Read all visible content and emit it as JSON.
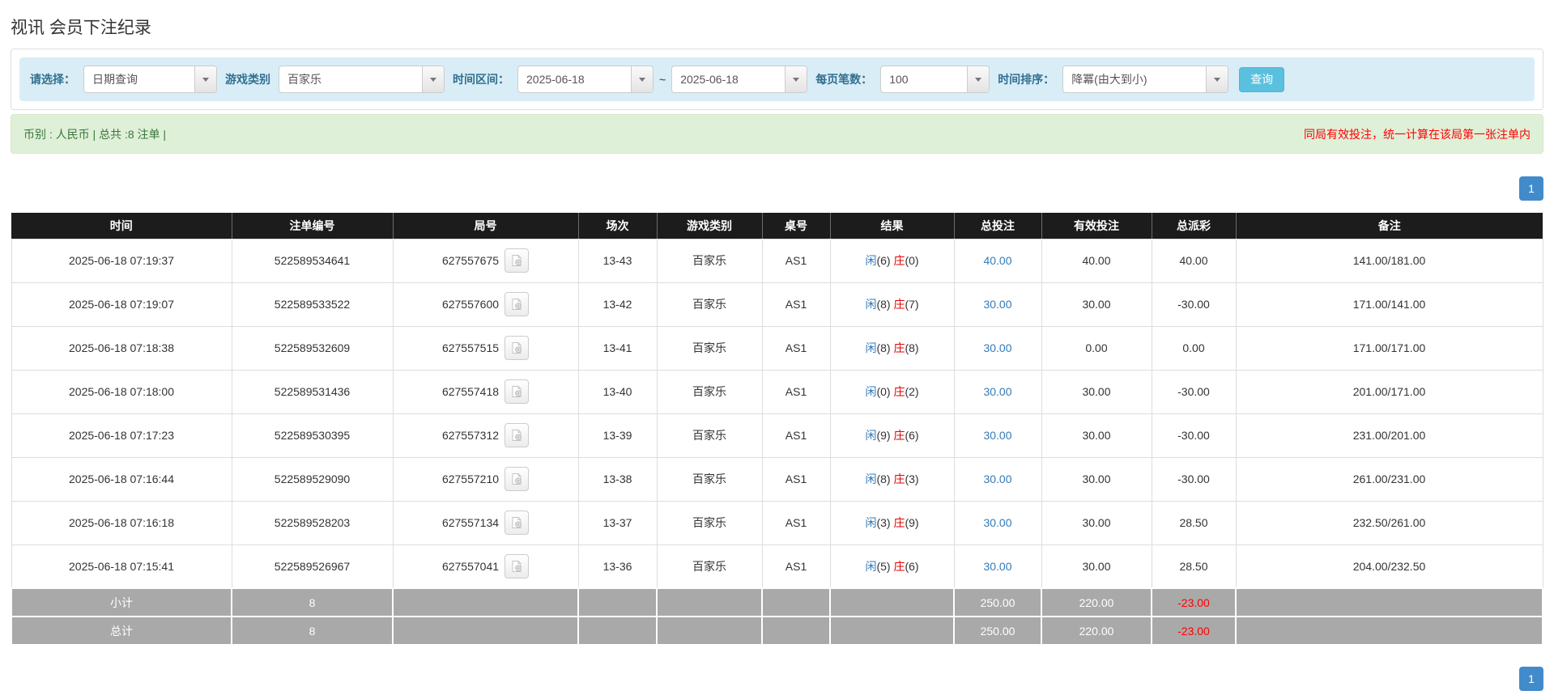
{
  "page": {
    "title": "视讯 会员下注纪录"
  },
  "filters": {
    "select_label": "请选择：",
    "select_value": "日期查询",
    "game_label": "游戏类别",
    "game_value": "百家乐",
    "range_label": "时间区间：",
    "date_from": "2025-06-18",
    "tilde": "~",
    "date_to": "2025-06-18",
    "per_page_label": "每页笔数：",
    "per_page_value": "100",
    "sort_label": "时间排序：",
    "sort_value": "降冪(由大到小)",
    "search_button": "查询"
  },
  "summary": {
    "left": "币别 : 人民币 | 总共 :8 注单 |",
    "right": "同局有效投注，统一计算在该局第一张注单内"
  },
  "pagination": {
    "page": "1"
  },
  "icons": {
    "round_video": "film-record-icon",
    "select_arrow": "chevron-down-icon"
  },
  "colors": {
    "accent_button": "#5bc0de",
    "filter_bar_bg": "#d9edf7",
    "filter_label": "#31708f",
    "alert_bg": "#dff0d8",
    "alert_text": "#3c763d",
    "notice_red": "#ff0000",
    "header_bg": "#1c1c1c",
    "link_blue": "#337ab7",
    "banker_red": "#e60000",
    "summary_row_bg": "#a9a9a9",
    "pager_blue": "#428bca"
  },
  "table": {
    "columns": [
      "时间",
      "注单编号",
      "局号",
      "场次",
      "游戏类别",
      "桌号",
      "结果",
      "总投注",
      "有效投注",
      "总派彩",
      "备注"
    ],
    "rows": [
      {
        "time": "2025-06-18 07:19:37",
        "bet_id": "522589534641",
        "round": "627557675",
        "session": "13-43",
        "game": "百家乐",
        "table_no": "AS1",
        "result": {
          "xian_label": "闲",
          "xian_num": "(6)",
          "zhuang_label": "庄",
          "zhuang_num": "(0)"
        },
        "total_bet": "40.00",
        "valid_bet": "40.00",
        "payout": "40.00",
        "remark": "141.00/181.00"
      },
      {
        "time": "2025-06-18 07:19:07",
        "bet_id": "522589533522",
        "round": "627557600",
        "session": "13-42",
        "game": "百家乐",
        "table_no": "AS1",
        "result": {
          "xian_label": "闲",
          "xian_num": "(8)",
          "zhuang_label": "庄",
          "zhuang_num": "(7)"
        },
        "total_bet": "30.00",
        "valid_bet": "30.00",
        "payout": "-30.00",
        "remark": "171.00/141.00"
      },
      {
        "time": "2025-06-18 07:18:38",
        "bet_id": "522589532609",
        "round": "627557515",
        "session": "13-41",
        "game": "百家乐",
        "table_no": "AS1",
        "result": {
          "xian_label": "闲",
          "xian_num": "(8)",
          "zhuang_label": "庄",
          "zhuang_num": "(8)"
        },
        "total_bet": "30.00",
        "valid_bet": "0.00",
        "payout": "0.00",
        "remark": "171.00/171.00"
      },
      {
        "time": "2025-06-18 07:18:00",
        "bet_id": "522589531436",
        "round": "627557418",
        "session": "13-40",
        "game": "百家乐",
        "table_no": "AS1",
        "result": {
          "xian_label": "闲",
          "xian_num": "(0)",
          "zhuang_label": "庄",
          "zhuang_num": "(2)"
        },
        "total_bet": "30.00",
        "valid_bet": "30.00",
        "payout": "-30.00",
        "remark": "201.00/171.00"
      },
      {
        "time": "2025-06-18 07:17:23",
        "bet_id": "522589530395",
        "round": "627557312",
        "session": "13-39",
        "game": "百家乐",
        "table_no": "AS1",
        "result": {
          "xian_label": "闲",
          "xian_num": "(9)",
          "zhuang_label": "庄",
          "zhuang_num": "(6)"
        },
        "total_bet": "30.00",
        "valid_bet": "30.00",
        "payout": "-30.00",
        "remark": "231.00/201.00"
      },
      {
        "time": "2025-06-18 07:16:44",
        "bet_id": "522589529090",
        "round": "627557210",
        "session": "13-38",
        "game": "百家乐",
        "table_no": "AS1",
        "result": {
          "xian_label": "闲",
          "xian_num": "(8)",
          "zhuang_label": "庄",
          "zhuang_num": "(3)"
        },
        "total_bet": "30.00",
        "valid_bet": "30.00",
        "payout": "-30.00",
        "remark": "261.00/231.00"
      },
      {
        "time": "2025-06-18 07:16:18",
        "bet_id": "522589528203",
        "round": "627557134",
        "session": "13-37",
        "game": "百家乐",
        "table_no": "AS1",
        "result": {
          "xian_label": "闲",
          "xian_num": "(3)",
          "zhuang_label": "庄",
          "zhuang_num": "(9)"
        },
        "total_bet": "30.00",
        "valid_bet": "30.00",
        "payout": "28.50",
        "remark": "232.50/261.00"
      },
      {
        "time": "2025-06-18 07:15:41",
        "bet_id": "522589526967",
        "round": "627557041",
        "session": "13-36",
        "game": "百家乐",
        "table_no": "AS1",
        "result": {
          "xian_label": "闲",
          "xian_num": "(5)",
          "zhuang_label": "庄",
          "zhuang_num": "(6)"
        },
        "total_bet": "30.00",
        "valid_bet": "30.00",
        "payout": "28.50",
        "remark": "204.00/232.50"
      }
    ],
    "subtotal": {
      "label": "小计",
      "count": "8",
      "total_bet": "250.00",
      "valid_bet": "220.00",
      "payout": "-23.00"
    },
    "total": {
      "label": "总计",
      "count": "8",
      "total_bet": "250.00",
      "valid_bet": "220.00",
      "payout": "-23.00"
    }
  }
}
